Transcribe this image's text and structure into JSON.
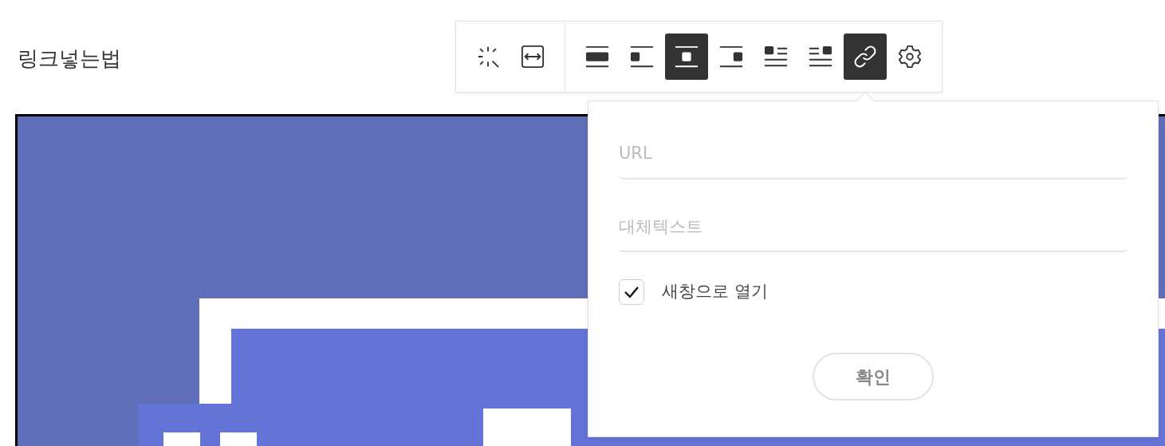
{
  "title": "링크넣는법",
  "toolbar": {
    "groups": [
      [
        {
          "kind": "magic",
          "selected": false
        },
        {
          "kind": "resize",
          "selected": false
        }
      ],
      [
        {
          "kind": "align-full",
          "selected": false
        },
        {
          "kind": "align-left",
          "selected": false
        },
        {
          "kind": "align-center",
          "selected": true
        },
        {
          "kind": "align-right",
          "selected": false
        },
        {
          "kind": "wrap-left",
          "selected": false
        },
        {
          "kind": "wrap-right",
          "selected": false
        },
        {
          "kind": "link",
          "selected": true
        },
        {
          "kind": "settings",
          "selected": false
        }
      ]
    ]
  },
  "link_popup": {
    "url": {
      "placeholder": "URL"
    },
    "alt_text": {
      "placeholder": "대체텍스트"
    },
    "new_window": {
      "label": "새창으로 열기",
      "checked": true
    },
    "confirm_button": "확인"
  }
}
